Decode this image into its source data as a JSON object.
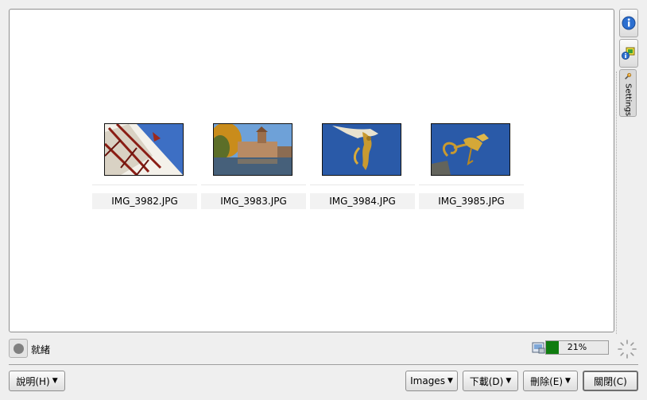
{
  "images": [
    {
      "name": "IMG_3982.JPG"
    },
    {
      "name": "IMG_3983.JPG"
    },
    {
      "name": "IMG_3984.JPG"
    },
    {
      "name": "IMG_3985.JPG"
    }
  ],
  "sidebar": {
    "tabs": [
      {
        "icon": "info-icon"
      },
      {
        "icon": "image-info-icon"
      },
      {
        "icon": "wrench-icon",
        "label": "Settings"
      }
    ]
  },
  "status": {
    "text": "就緒",
    "storage_percent": 21,
    "storage_label": "21%"
  },
  "buttons": {
    "help": "說明(H)",
    "images": "Images",
    "download": "下載(D)",
    "delete": "刪除(E)",
    "close": "關閉(C)"
  },
  "colors": {
    "progress": "#0f7c0f",
    "sky": "#2a5aa8"
  }
}
